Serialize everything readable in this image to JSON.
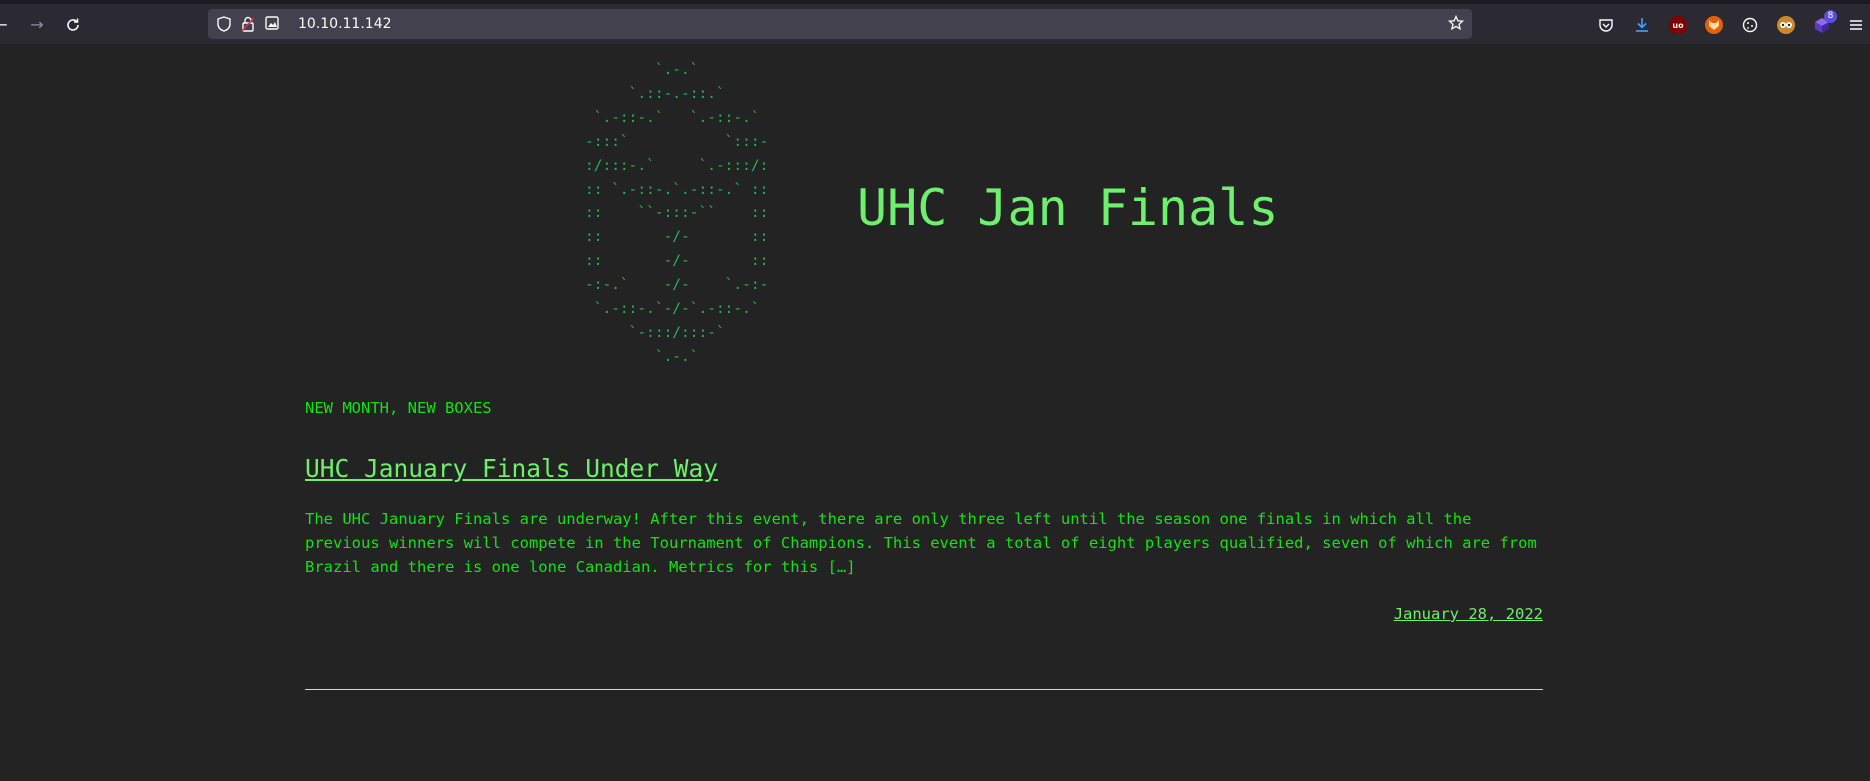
{
  "browser": {
    "url": "10.10.11.142",
    "back_icon": "back-arrow-icon",
    "forward_icon": "forward-arrow-icon",
    "reload_icon": "reload-icon",
    "extensions": [
      {
        "name": "pocket-icon",
        "color": "#fbfbfe"
      },
      {
        "name": "downloads-icon",
        "color": "#4a9df8"
      },
      {
        "name": "ublock-origin-icon",
        "color": "#800000",
        "label": "uo"
      },
      {
        "name": "fox-extension-icon",
        "color": "#e66000"
      },
      {
        "name": "cookie-icon",
        "color": "#fbfbfe"
      },
      {
        "name": "owl-extension-icon",
        "color": "#f0c040"
      },
      {
        "name": "cube-extension-icon",
        "color": "#6a3fd8",
        "badge": "8"
      }
    ],
    "menu_icon": "hamburger-menu-icon"
  },
  "site": {
    "ascii_logo": "        `.-.`\n     `.::-.-::.`\n `.-::-.`   `.-::-.`\n-:::`           `:::-\n:/:::-.`     `.-:::/:\n:: `.-::-.`.-::-.` ::\n::    ``-:::-``    ::\n::       -/-       ::\n::       -/-       ::\n-:-.`    -/-    `.-:-\n `.-::-.`-/-`.-::-.`\n     `-:::/:::-`\n        `.-.`",
    "title": "UHC Jan Finals",
    "tagline": "NEW MONTH, NEW BOXES"
  },
  "post": {
    "title": "UHC January Finals Under Way",
    "excerpt": "The UHC January Finals are underway! After this event, there are only three left until the season one finals in which all the previous winners will compete in the Tournament of Champions. This event a total of eight players qualified, seven of which are from Brazil and there is one lone Canadian. Metrics for this […]",
    "date": "January 28, 2022"
  },
  "colors": {
    "background": "#232323",
    "accent_green": "#6ef06e",
    "text_green": "#16e016",
    "ascii_green": "#1fb85a"
  }
}
